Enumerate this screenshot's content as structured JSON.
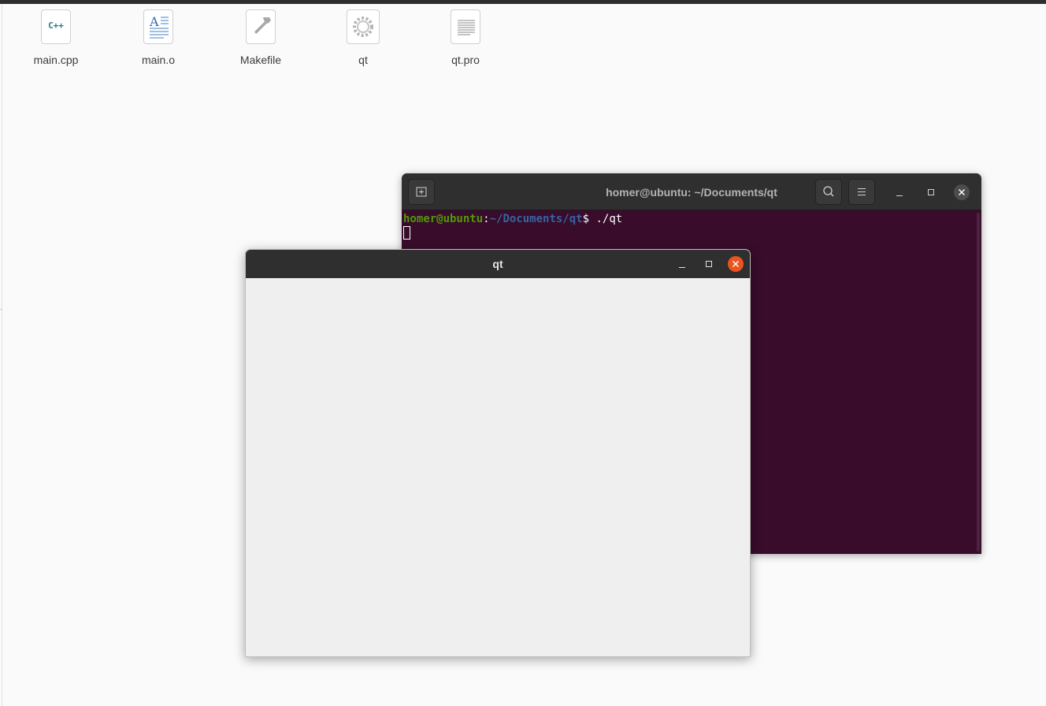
{
  "desktop": {
    "files": [
      {
        "name": "main.cpp",
        "icon": "cpp-file-icon",
        "badge": "C++"
      },
      {
        "name": "main.o",
        "icon": "text-document-icon"
      },
      {
        "name": "Makefile",
        "icon": "makefile-hammer-icon"
      },
      {
        "name": "qt",
        "icon": "executable-gear-icon"
      },
      {
        "name": "qt.pro",
        "icon": "plain-text-file-icon"
      }
    ]
  },
  "terminal": {
    "title": "homer@ubuntu: ~/Documents/qt",
    "prompt_user": "homer@ubuntu",
    "prompt_sep": ":",
    "prompt_path": "~/Documents/qt",
    "prompt_symbol": "$ ",
    "command": "./qt",
    "colors": {
      "background": "#380c2a",
      "user": "#4e9a06",
      "path": "#3465a4"
    }
  },
  "qt_window": {
    "title": "qt",
    "colors": {
      "close_button": "#e95420",
      "body": "#efefef"
    }
  }
}
